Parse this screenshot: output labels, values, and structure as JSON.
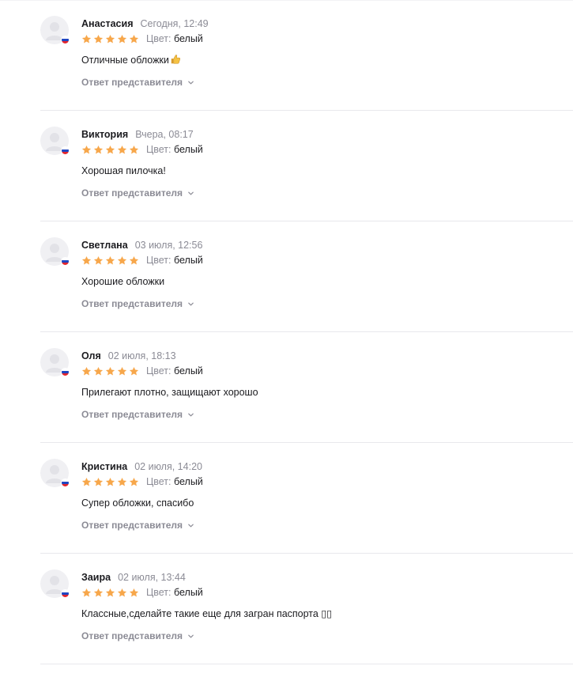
{
  "reviews": [
    {
      "author": "Анастасия",
      "date": "Сегодня, 12:49",
      "rating": 5,
      "variant_label": "Цвет:",
      "variant_value": "белый",
      "text": "Отличные обложки",
      "emoji": "thumbs-up",
      "reply_label": "Ответ представителя"
    },
    {
      "author": "Виктория",
      "date": "Вчера, 08:17",
      "rating": 5,
      "variant_label": "Цвет:",
      "variant_value": "белый",
      "text": "Хорошая пилочка!",
      "reply_label": "Ответ представителя"
    },
    {
      "author": "Светлана",
      "date": "03 июля, 12:56",
      "rating": 5,
      "variant_label": "Цвет:",
      "variant_value": "белый",
      "text": "Хорошие обложки",
      "reply_label": "Ответ представителя"
    },
    {
      "author": "Оля",
      "date": "02 июля, 18:13",
      "rating": 5,
      "variant_label": "Цвет:",
      "variant_value": "белый",
      "text": "Прилегают плотно, защищают хорошо",
      "reply_label": "Ответ представителя"
    },
    {
      "author": "Кристина",
      "date": "02 июля, 14:20",
      "rating": 5,
      "variant_label": "Цвет:",
      "variant_value": "белый",
      "text": "Супер обложки, спасибо",
      "reply_label": "Ответ представителя"
    },
    {
      "author": "Заира",
      "date": "02 июля, 13:44",
      "rating": 5,
      "variant_label": "Цвет:",
      "variant_value": "белый",
      "text": "Классные,сделайте такие еще для загран паспорта ▯▯",
      "reply_label": "Ответ представителя"
    }
  ],
  "colors": {
    "star": "#f7a74b",
    "muted_text": "#8b8b95",
    "divider": "#e8e8ec",
    "avatar_bg": "#f0f0f3"
  },
  "icons": {
    "avatar": "user-silhouette-icon",
    "flag": "russia-flag-icon",
    "star": "star-filled-icon",
    "chevron": "chevron-down-icon",
    "emoji": "thumbs-up-icon"
  }
}
